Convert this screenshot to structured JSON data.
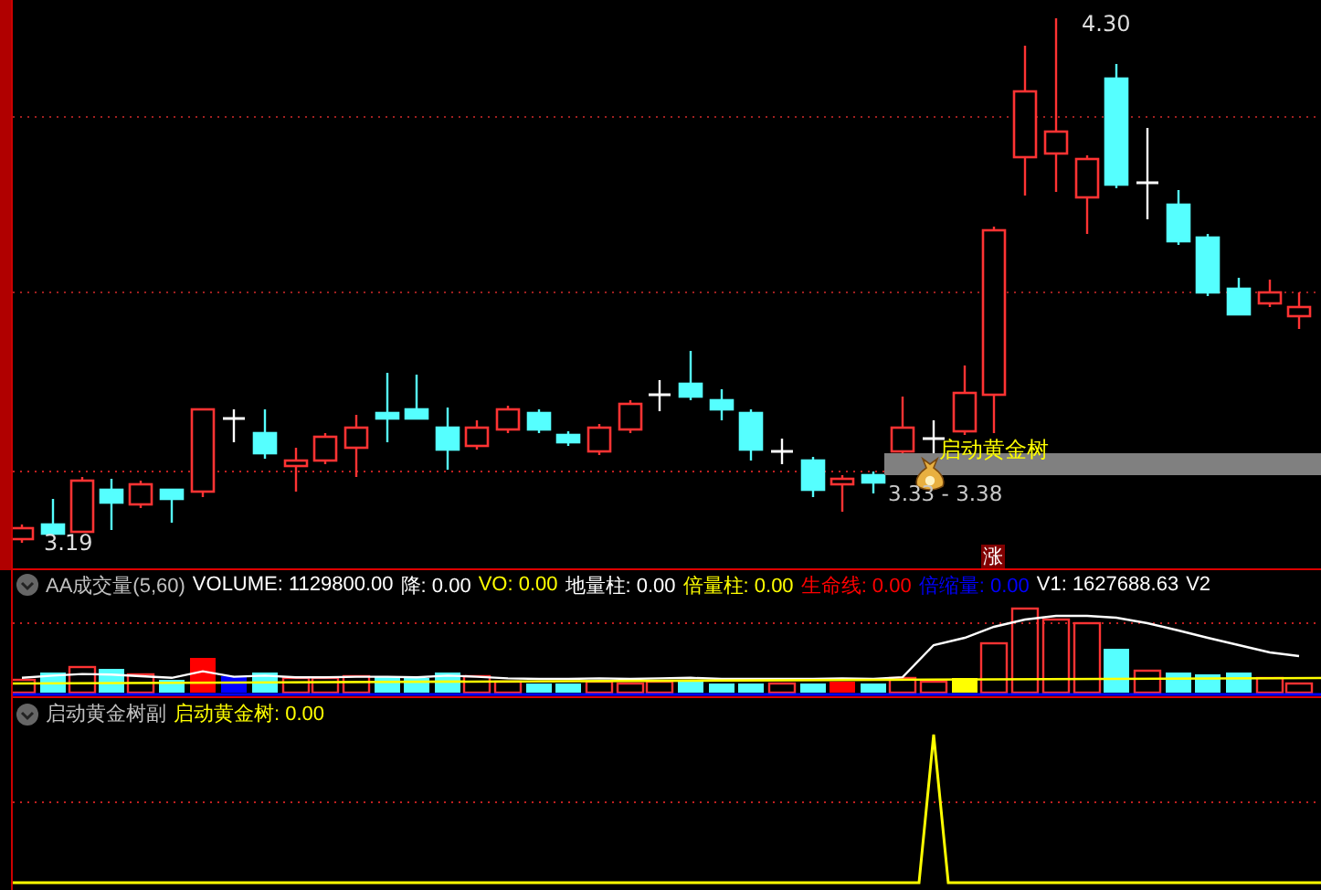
{
  "main_chart": {
    "high_label": "4.30",
    "low_label": "3.19",
    "signal": {
      "label": "启动黄金树",
      "range": "3.33 - 3.38"
    },
    "badge": "涨"
  },
  "volume_panel": {
    "title": "AA成交量(5,60)",
    "indicators": [
      {
        "label": "VOLUME: 1129800.00",
        "color": "#ffffff"
      },
      {
        "label": "降: 0.00",
        "color": "#ffffff"
      },
      {
        "label": "VO: 0.00",
        "color": "#ffff00"
      },
      {
        "label": "地量柱: 0.00",
        "color": "#ffffff"
      },
      {
        "label": "倍量柱: 0.00",
        "color": "#ffff00"
      },
      {
        "label": "生命线: 0.00",
        "color": "#ff0000"
      },
      {
        "label": "倍缩量: 0.00",
        "color": "#0000ff"
      },
      {
        "label": "V1: 1627688.63",
        "color": "#ffffff"
      },
      {
        "label": "V2",
        "color": "#ffffff"
      }
    ]
  },
  "sub_panel": {
    "title": "启动黄金树副",
    "indicators": [
      {
        "label": "启动黄金树: 0.00",
        "color": "#ffff00"
      }
    ]
  }
}
